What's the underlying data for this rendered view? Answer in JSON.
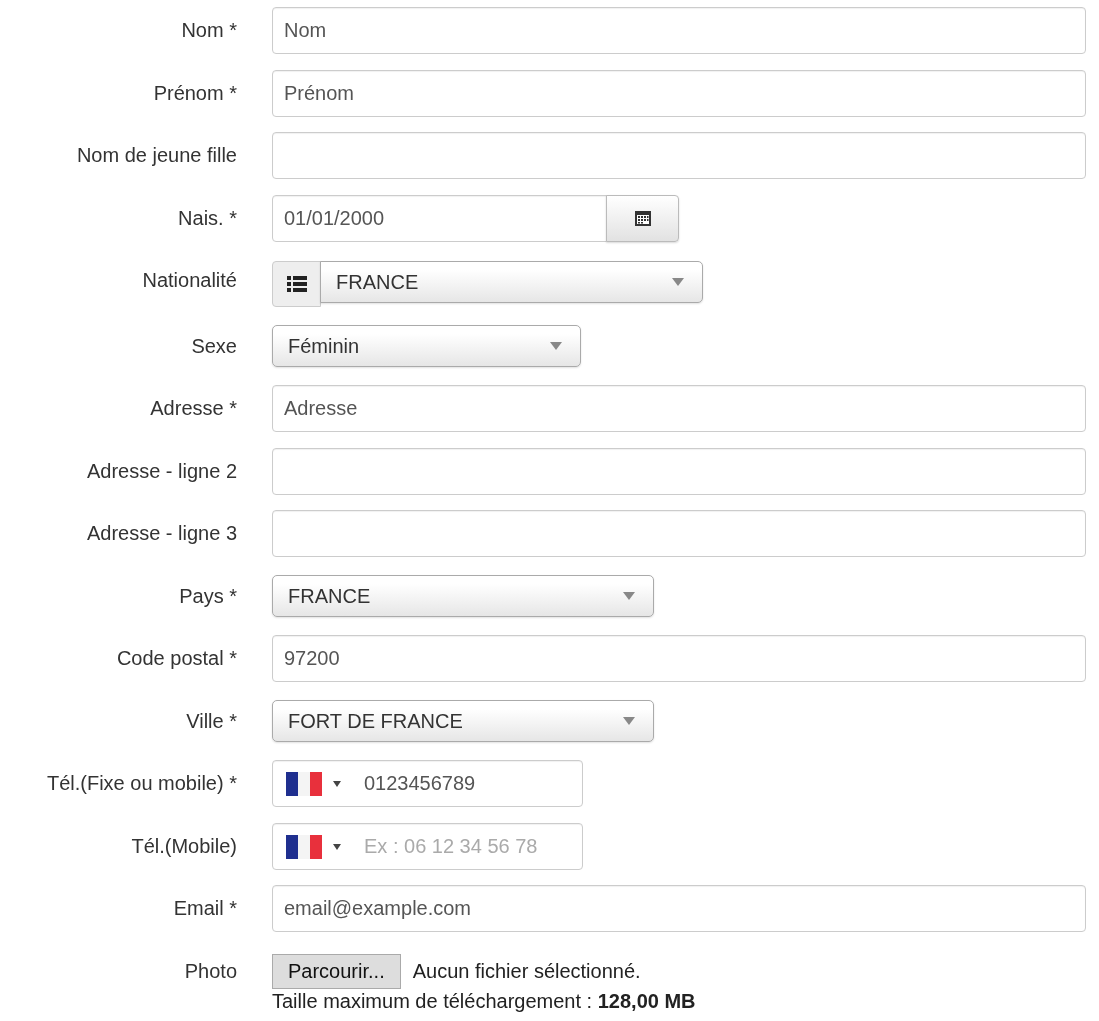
{
  "form": {
    "rows": [
      {
        "label": "Nom *",
        "kind": "text",
        "value": "Nom"
      },
      {
        "label": "Prénom *",
        "kind": "text",
        "value": "Prénom"
      },
      {
        "label": "Nom de jeune fille",
        "kind": "text"
      },
      {
        "label": "Nais. *",
        "kind": "date",
        "value": "01/01/2000"
      },
      {
        "label": "Nationalité",
        "kind": "addon_select",
        "value": "FRANCE"
      },
      {
        "label": "Sexe",
        "kind": "short_select",
        "value": "Féminin"
      },
      {
        "label": "Adresse *",
        "kind": "text",
        "value": "Adresse"
      },
      {
        "label": "Adresse - ligne 2",
        "kind": "text"
      },
      {
        "label": "Adresse - ligne 3",
        "kind": "text"
      },
      {
        "label": "Pays *",
        "kind": "select",
        "value": "FRANCE"
      },
      {
        "label": "Code postal *",
        "kind": "text",
        "value": "97200"
      },
      {
        "label": "Ville *",
        "kind": "select",
        "value": "FORT DE FRANCE"
      },
      {
        "label": "Tél.(Fixe ou mobile) *",
        "kind": "phone",
        "value": "0123456789"
      },
      {
        "label": "Tél.(Mobile)",
        "kind": "phone",
        "placeholder": "Ex : 06 12 34 56 78"
      },
      {
        "label": "Email *",
        "kind": "text",
        "value": "email@example.com"
      },
      {
        "label": "Photo",
        "kind": "file",
        "button": "Parcourir...",
        "status": "Aucun fichier sélectionné.",
        "note": "Taille maximum de téléchargement : **128,00 MB**"
      }
    ]
  }
}
